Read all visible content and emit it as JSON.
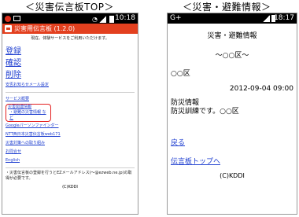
{
  "captions": {
    "left": "＜災害伝言板TOP＞",
    "right": "＜災害・避難情報＞"
  },
  "left_phone": {
    "status_time": "10:18",
    "app_title": "災害用伝言板 (1.2.0)",
    "notice": "現在、体験サービスをご利用いただけます。",
    "main_links": [
      "登録",
      "確認",
      "削除"
    ],
    "mail_setting_link": "安否お知らせメール設定",
    "service_links": [
      "サービス概要",
      "Googleパーソンファインダー",
      "NTT西日本災害伝言板web171",
      "災害対策への取り組み",
      "お問合せ",
      "English"
    ],
    "highlight": {
      "main": "災害関連情報",
      "sub": "・避難の災害情報 など"
    },
    "footnote": "・災害伝言板の登録を行うとEZメールアドレス(〜@ezweb.ne.jp)の取得が必要です。",
    "copyright": "(C)KDDI"
  },
  "right_phone": {
    "status_left": "G+",
    "status_time": "18:17",
    "title": "災害・避難情報",
    "region": "〜○○区〜",
    "place": "○○区",
    "datetime": "2012-09-04 09:00",
    "info_line1": "防災情報",
    "info_line2": "防災訓練です。○○区",
    "back_link": "戻る",
    "top_link": "伝言板トップへ",
    "copyright": "(C)KDDI"
  }
}
